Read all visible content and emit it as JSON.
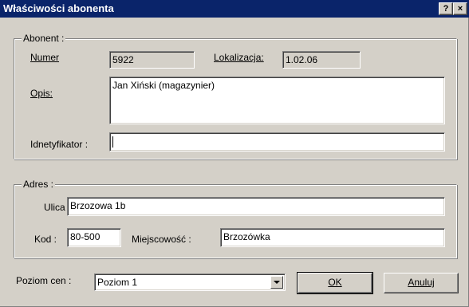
{
  "window": {
    "title": "Właściwości abonenta",
    "help_label": "?",
    "close_label": "×"
  },
  "abonent": {
    "group_label": "Abonent :",
    "numer_label": "Numer",
    "numer_value": "5922",
    "lokalizacja_label": "Lokalizacja:",
    "lokalizacja_value": "1.02.06",
    "opis_label": "Opis:",
    "opis_value": "Jan Xiński (magazynier)",
    "identyfikator_label": "Idnetyfikator :",
    "identyfikator_value": ""
  },
  "adres": {
    "group_label": "Adres :",
    "ulica_label": "Ulica",
    "ulica_value": "Brzozowa 1b",
    "kod_label": "Kod :",
    "kod_value": "80-500",
    "miejscowosc_label": "Miejscowość :",
    "miejscowosc_value": "Brzozówka"
  },
  "footer": {
    "poziom_cen_label": "Poziom cen :",
    "poziom_cen_selected": "Poziom 1",
    "ok_label": "OK",
    "anuluj_label": "Anuluj"
  }
}
